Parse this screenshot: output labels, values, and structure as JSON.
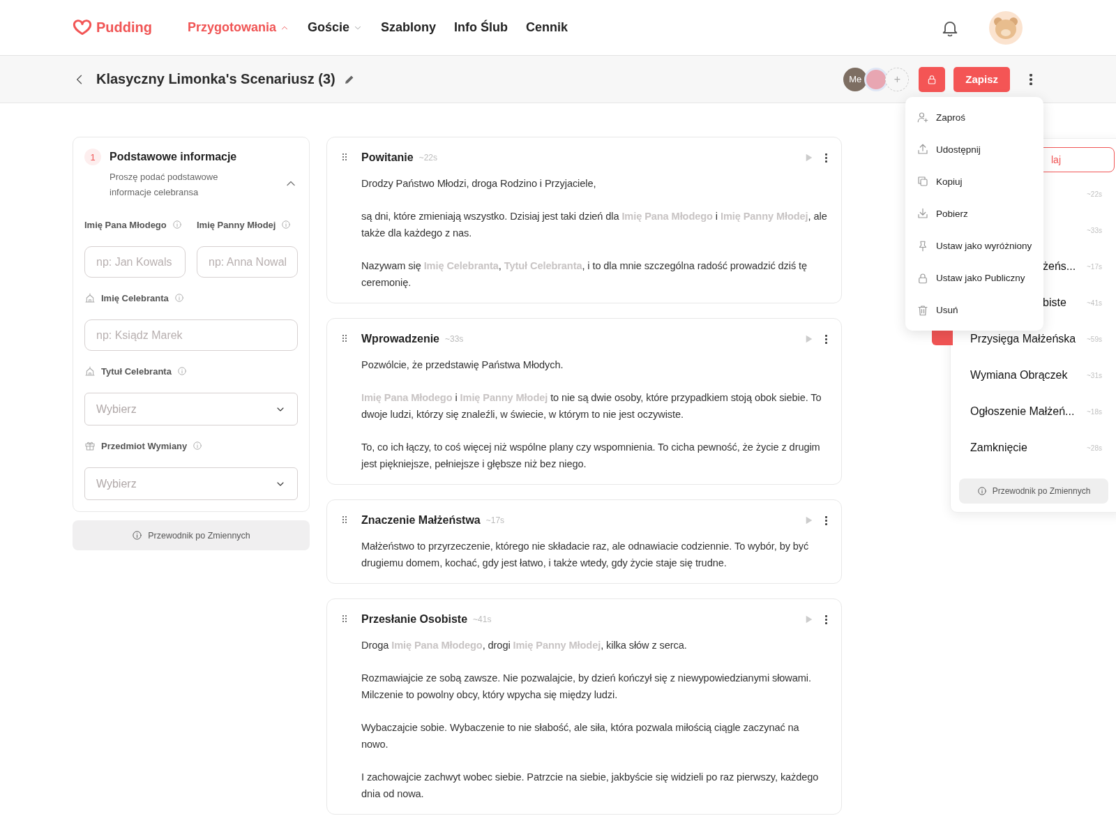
{
  "nav": {
    "brand": "Pudding",
    "items": [
      {
        "label": "Przygotowania",
        "selected": true,
        "kind": "menu",
        "expanded": true
      },
      {
        "label": "Goście",
        "selected": false,
        "kind": "menu",
        "expanded": false
      },
      {
        "label": "Szablony",
        "selected": false,
        "kind": "link"
      },
      {
        "label": "Info Ślub",
        "selected": false,
        "kind": "link"
      },
      {
        "label": "Cennik",
        "selected": false,
        "kind": "link"
      }
    ]
  },
  "toolbar": {
    "title": "Klasyczny Limonka's Scenariusz (3)",
    "collaborators": [
      {
        "kind": "initials",
        "label": "Me"
      },
      {
        "kind": "picture"
      },
      {
        "kind": "add",
        "label": "+"
      }
    ],
    "save": "Zapisz"
  },
  "menu": [
    "Zaproś",
    "Udostępnij",
    "Kopiuj",
    "Pobierz",
    "Ustaw jako wyróżniony",
    "Ustaw jako Publiczny",
    "Usuń"
  ],
  "form": {
    "step": "1",
    "title": "Podstawowe informacje",
    "subtitle": "Proszę podać podstawowe informacje celebransa",
    "expanded": true,
    "fields": [
      {
        "kind": "text",
        "label": "Imię Pana Młodego",
        "placeholder": "np: Jan Kowals"
      },
      {
        "kind": "text",
        "label": "Imię Panny Młodej",
        "placeholder": "np: Anna Nowal"
      },
      {
        "kind": "text",
        "label": "Imię Celebranta",
        "placeholder": "np: Ksiądz Marek"
      },
      {
        "kind": "select",
        "label": "Tytuł Celebranta",
        "placeholder": "Wybierz"
      },
      {
        "kind": "select",
        "label": "Przedmiot Wymiany",
        "placeholder": "Wybierz"
      }
    ],
    "guide": "Przewodnik po Zmiennych"
  },
  "sections": [
    {
      "name": "Powitanie",
      "duration": "~22s",
      "paragraphs": [
        "Drodzy Państwo Młodzi, droga Rodzino i Przyjaciele,",
        "są dni, które zmieniają wszystko. Dzisiaj jest taki dzień dla **Imię Pana Młodego** i **Imię Panny Młodej**, ale także dla każdego z nas.",
        "Nazywam się **Imię Celebranta**, **Tytuł Celebranta**, i to dla mnie szczególna radość prowadzić dziś tę ceremonię."
      ]
    },
    {
      "name": "Wprowadzenie",
      "duration": "~33s",
      "paragraphs": [
        "Pozwólcie, że przedstawię Państwa Młodych.",
        "**Imię Pana Młodego** i **Imię Panny Młodej** to nie są dwie osoby, które przypadkiem stoją obok siebie. To dwoje ludzi, którzy się znaleźli, w świecie, w którym to nie jest oczywiste.",
        "To, co ich łączy, to coś więcej niż wspólne plany czy wspomnienia. To cicha pewność, że życie z drugim jest piękniejsze, pełniejsze i głębsze niż bez niego."
      ]
    },
    {
      "name": "Znaczenie Małżeństwa",
      "duration": "~17s",
      "paragraphs": [
        "Małżeństwo to przyrzeczenie, którego nie składacie raz, ale odnawiacie codziennie. To wybór, by być drugiemu domem, kochać, gdy jest łatwo, i także wtedy, gdy życie staje się trudne."
      ]
    },
    {
      "name": "Przesłanie Osobiste",
      "duration": "~41s",
      "paragraphs": [
        "Droga **Imię Pana Młodego**, drogi **Imię Panny Młodej**, kilka słów z serca.",
        "Rozmawiajcie ze sobą zawsze. Nie pozwalajcie, by dzień kończył się z niewypowiedzianymi słowami. Milczenie to powolny obcy, który wpycha się między ludzi.",
        "Wybaczajcie sobie. Wybaczenie to nie słabość, ale siła, która pozwala miłością ciągle zaczynać na nowo.",
        "I zachowajcie zachwyt wobec siebie. Patrzcie na siebie, jakbyście się widzieli po raz pierwszy, każdego dnia od nowa."
      ]
    }
  ],
  "outline": {
    "button": "laj",
    "items": [
      {
        "kind": "hidden",
        "duration": "~22s"
      },
      {
        "kind": "hidden",
        "duration": "~33s"
      },
      {
        "kind": "cut",
        "name": "żeńs...",
        "duration": "~17s"
      },
      {
        "kind": "cut",
        "name": "biste",
        "duration": "~41s"
      },
      {
        "kind": "full",
        "name": "Przysięga Małżeńska",
        "duration": "~59s"
      },
      {
        "kind": "full",
        "name": "Wymiana Obrączek",
        "duration": "~31s"
      },
      {
        "kind": "full",
        "name": "Ogłoszenie Małżeń...",
        "duration": "~18s"
      },
      {
        "kind": "full",
        "name": "Zamknięcie",
        "duration": "~28s"
      }
    ],
    "guide": "Przewodnik po Zmiennych"
  }
}
